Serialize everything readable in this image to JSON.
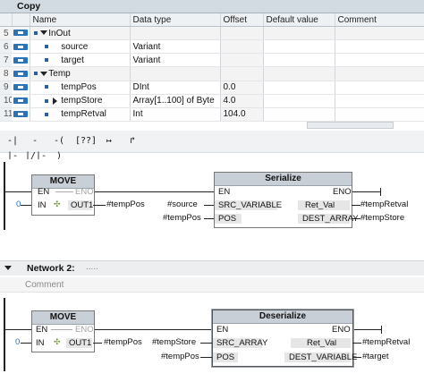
{
  "title": "Copy",
  "table": {
    "headers": [
      "Name",
      "Data type",
      "Offset",
      "Default value",
      "Comment"
    ],
    "rows": [
      {
        "num": "5",
        "name": "InOut",
        "type": "",
        "offset": "",
        "level": 0,
        "expand": "down",
        "section": true
      },
      {
        "num": "6",
        "name": "source",
        "type": "Variant",
        "offset": "",
        "level": 1,
        "expand": "",
        "section": false
      },
      {
        "num": "7",
        "name": "target",
        "type": "Variant",
        "offset": "",
        "level": 1,
        "expand": "",
        "section": false
      },
      {
        "num": "8",
        "name": "Temp",
        "type": "",
        "offset": "",
        "level": 0,
        "expand": "down",
        "section": true
      },
      {
        "num": "9",
        "name": "tempPos",
        "type": "DInt",
        "offset": "0.0",
        "level": 1,
        "expand": "",
        "section": false
      },
      {
        "num": "10",
        "name": "tempStore",
        "type": "Array[1..100] of Byte",
        "offset": "4.0",
        "level": 1,
        "expand": "right",
        "section": false
      },
      {
        "num": "11",
        "name": "tempRetval",
        "type": "Int",
        "offset": "104.0",
        "level": 1,
        "expand": "",
        "section": false
      }
    ]
  },
  "toolbar": [
    {
      "glyph": "-| |-",
      "name": "contact-no-button"
    },
    {
      "glyph": "-|/|-",
      "name": "contact-nc-button"
    },
    {
      "glyph": "-( )",
      "name": "coil-button"
    },
    {
      "glyph": "[??]",
      "name": "empty-box-button"
    },
    {
      "glyph": "↦",
      "name": "open-branch-button"
    },
    {
      "glyph": "↱",
      "name": "close-branch-button"
    }
  ],
  "network1": {
    "move": {
      "title": "MOVE",
      "en": "EN",
      "eno": "ENO",
      "in": "IN",
      "out": "OUT1",
      "in_value": "0",
      "out_value": "#tempPos"
    },
    "serialize": {
      "title": "Serialize",
      "en": "EN",
      "eno": "ENO",
      "src": "SRC_VARIABLE",
      "pos": "POS",
      "retval": "Ret_Val",
      "dest": "DEST_ARRAY",
      "src_value": "#source",
      "pos_value": "#tempPos",
      "retval_value": "#tempRetval",
      "dest_value": "#tempStore"
    }
  },
  "network2": {
    "label": "Network 2:",
    "dots": ".....",
    "comment": "Comment",
    "move": {
      "title": "MOVE",
      "en": "EN",
      "eno": "ENO",
      "in": "IN",
      "out": "OUT1",
      "in_value": "0",
      "out_value": "#tempPos"
    },
    "deserialize": {
      "title": "Deserialize",
      "en": "EN",
      "eno": "ENO",
      "src": "SRC_ARRAY",
      "pos": "POS",
      "retval": "Ret_Val",
      "dest": "DEST_VARIABLE",
      "src_value": "#tempStore",
      "pos_value": "#tempPos",
      "retval_value": "#tempRetval",
      "dest_value": "#target"
    }
  },
  "colors": {
    "accent": "#2b73b8",
    "block_header": "#c9cfd6",
    "pin_link": "#e07b00"
  }
}
